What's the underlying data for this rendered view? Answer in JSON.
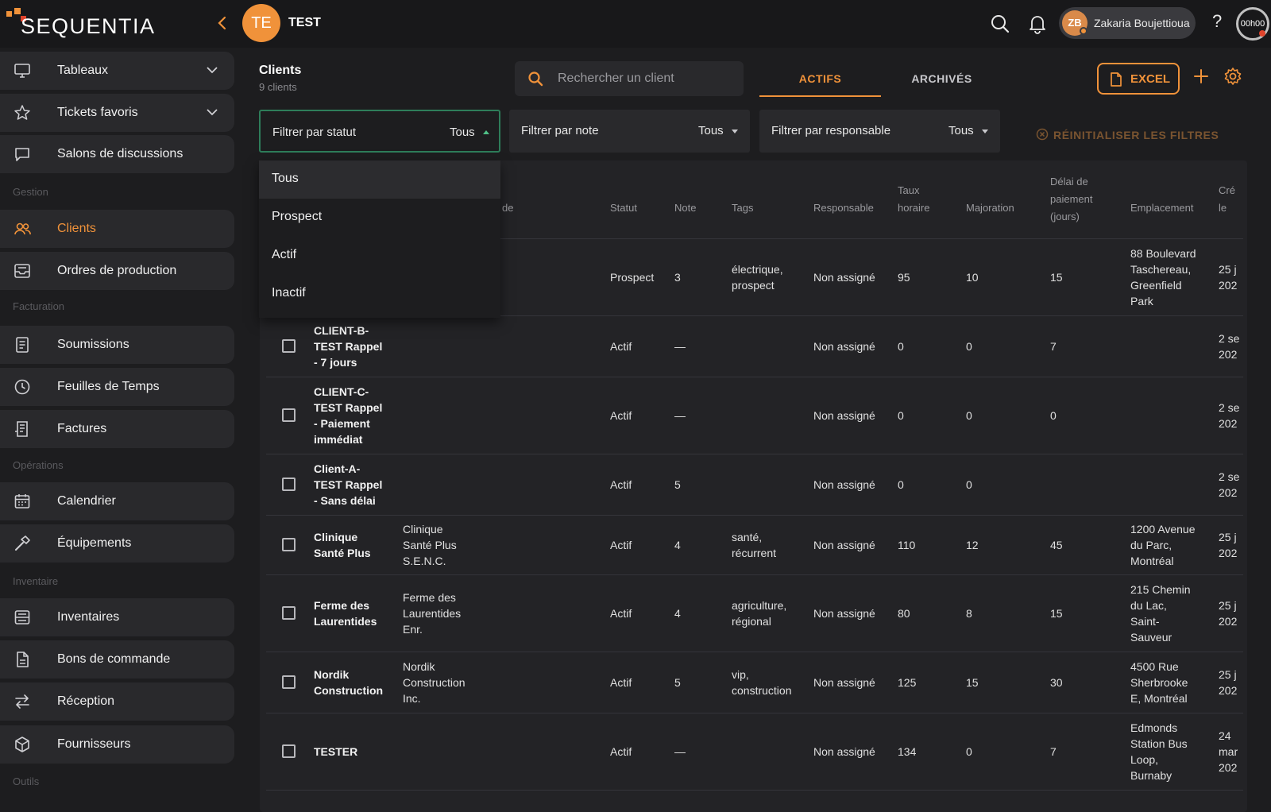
{
  "brand": {
    "name": "SEQUENTIA"
  },
  "project": {
    "initials": "TE",
    "name": "TEST"
  },
  "user": {
    "initials": "ZB",
    "name": "Zakaria Boujettioua"
  },
  "help_label": "?",
  "timer": "00h00",
  "colors": {
    "accent": "#f0923a",
    "success": "#4fc087",
    "panel": "#29292c"
  },
  "sidebar": {
    "items": [
      {
        "label": "Tableaux",
        "icon": "monitor-icon"
      },
      {
        "label": "Tickets favoris",
        "icon": "star-icon"
      },
      {
        "label": "Salons de discussions",
        "icon": "chat-icon"
      },
      {
        "label": "Clients",
        "icon": "users-icon"
      },
      {
        "label": "Ordres de production",
        "icon": "tray-icon"
      },
      {
        "label": "Soumissions",
        "icon": "document-icon"
      },
      {
        "label": "Feuilles de Temps",
        "icon": "clock-icon"
      },
      {
        "label": "Factures",
        "icon": "invoice-icon"
      },
      {
        "label": "Calendrier",
        "icon": "calendar-icon"
      },
      {
        "label": "Équipements",
        "icon": "hammer-icon"
      },
      {
        "label": "Inventaires",
        "icon": "inventory-icon"
      },
      {
        "label": "Bons de commande",
        "icon": "file-icon"
      },
      {
        "label": "Réception",
        "icon": "swap-icon"
      },
      {
        "label": "Fournisseurs",
        "icon": "box-icon"
      }
    ],
    "sections": [
      "Gestion",
      "Facturation",
      "Opérations",
      "Inventaire",
      "Outils"
    ]
  },
  "page": {
    "title": "Clients",
    "count": "9 clients"
  },
  "search": {
    "placeholder": "Rechercher un client"
  },
  "tabs": [
    {
      "label": "ACTIFS"
    },
    {
      "label": "ARCHIVÉS"
    }
  ],
  "excel_label": "EXCEL",
  "filters": [
    {
      "label": "Filtrer par statut",
      "value": "Tous"
    },
    {
      "label": "Filtrer par note",
      "value": "Tous"
    },
    {
      "label": "Filtrer par responsable",
      "value": "Tous"
    }
  ],
  "reset_label": "RÉINITIALISER LES FILTRES",
  "dropdown": {
    "options": [
      "Tous",
      "Prospect",
      "Actif",
      "Inactif"
    ],
    "selected": "Tous"
  },
  "table": {
    "headers": {
      "code": "de",
      "statut": "Statut",
      "note": "Note",
      "tags": "Tags",
      "responsable": "Responsable",
      "taux": [
        "Taux",
        "horaire"
      ],
      "majoration": "Majoration",
      "delai": [
        "Délai de",
        "paiement",
        "(jours)"
      ],
      "emplacement": "Emplacement",
      "cree": [
        "Cré",
        "le"
      ]
    },
    "rows": [
      {
        "name": [],
        "legal": [],
        "statut": "Prospect",
        "note": "3",
        "tags": [
          "électrique,",
          "prospect"
        ],
        "resp": "Non assigné",
        "taux": "95",
        "maj": "10",
        "delai": "15",
        "loc": [
          "88 Boulevard",
          "Taschereau,",
          "Greenfield",
          "Park"
        ],
        "cree": [
          "25 j",
          "202"
        ]
      },
      {
        "name": [
          "CLIENT-B-",
          "TEST Rappel",
          "- 7 jours"
        ],
        "legal": [],
        "statut": "Actif",
        "note": "—",
        "tags": [],
        "resp": "Non assigné",
        "taux": "0",
        "maj": "0",
        "delai": "7",
        "loc": [],
        "cree": [
          "2 se",
          "202"
        ]
      },
      {
        "name": [
          "CLIENT-C-",
          "TEST Rappel",
          "- Paiement",
          "immédiat"
        ],
        "legal": [],
        "statut": "Actif",
        "note": "—",
        "tags": [],
        "resp": "Non assigné",
        "taux": "0",
        "maj": "0",
        "delai": "0",
        "loc": [],
        "cree": [
          "2 se",
          "202"
        ]
      },
      {
        "name": [
          "Client-A-",
          "TEST Rappel",
          "- Sans délai"
        ],
        "legal": [],
        "statut": "Actif",
        "note": "5",
        "tags": [],
        "resp": "Non assigné",
        "taux": "0",
        "maj": "0",
        "delai": "",
        "loc": [],
        "cree": [
          "2 se",
          "202"
        ]
      },
      {
        "name": [
          "Clinique",
          "Santé Plus"
        ],
        "legal": [
          "Clinique",
          "Santé Plus",
          "S.E.N.C."
        ],
        "statut": "Actif",
        "note": "4",
        "tags": [
          "santé,",
          "récurrent"
        ],
        "resp": "Non assigné",
        "taux": "110",
        "maj": "12",
        "delai": "45",
        "loc": [
          "1200 Avenue",
          "du Parc,",
          "Montréal"
        ],
        "cree": [
          "25 j",
          "202"
        ]
      },
      {
        "name": [
          "Ferme des",
          "Laurentides"
        ],
        "legal": [
          "Ferme des",
          "Laurentides",
          "Enr."
        ],
        "statut": "Actif",
        "note": "4",
        "tags": [
          "agriculture,",
          "régional"
        ],
        "resp": "Non assigné",
        "taux": "80",
        "maj": "8",
        "delai": "15",
        "loc": [
          "215 Chemin",
          "du Lac,",
          "Saint-",
          "Sauveur"
        ],
        "cree": [
          "25 j",
          "202"
        ]
      },
      {
        "name": [
          "Nordik",
          "Construction"
        ],
        "legal": [
          "Nordik",
          "Construction",
          "Inc."
        ],
        "statut": "Actif",
        "note": "5",
        "tags": [
          "vip,",
          "construction"
        ],
        "resp": "Non assigné",
        "taux": "125",
        "maj": "15",
        "delai": "30",
        "loc": [
          "4500 Rue",
          "Sherbrooke",
          "E, Montréal"
        ],
        "cree": [
          "25 j",
          "202"
        ]
      },
      {
        "name": [
          "TESTER"
        ],
        "legal": [],
        "statut": "Actif",
        "note": "—",
        "tags": [],
        "resp": "Non assigné",
        "taux": "134",
        "maj": "0",
        "delai": "7",
        "loc": [
          "Edmonds",
          "Station Bus",
          "Loop,",
          "Burnaby"
        ],
        "cree": [
          "24",
          "mar",
          "202"
        ]
      }
    ]
  }
}
